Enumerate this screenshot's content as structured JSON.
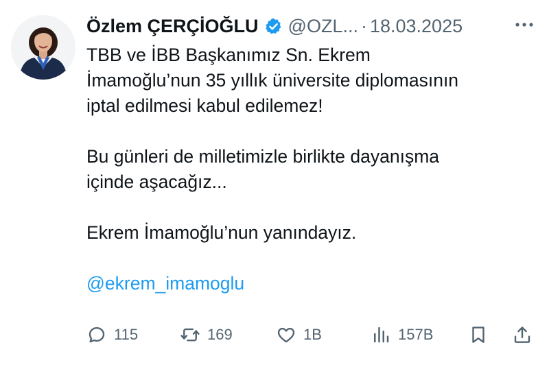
{
  "author": {
    "name": "Özlem ÇERÇİOĞLU",
    "handle": "@OZL...",
    "separator": "·",
    "date": "18.03.2025",
    "avatar_icon": "profile-photo",
    "verified_icon": "verified-badge-icon",
    "verified_color": "#1d9bf0"
  },
  "tweet": {
    "line1": "TBB ve İBB Başkanımız Sn. Ekrem",
    "line2": "İmamoğlu’nun 35 yıllık üniversite diplomasının",
    "line3": "iptal edilmesi kabul edilemez!",
    "line4": "Bu günleri de milletimizle birlikte dayanışma",
    "line5": "içinde aşacağız...",
    "line6": "Ekrem İmamoğlu’nun yanındayız.",
    "mention": "@ekrem_imamoglu",
    "mention_color": "#1d9bf0"
  },
  "actions": {
    "replies": "115",
    "retweets": "169",
    "likes": "1B",
    "views": "157B",
    "icons": [
      "reply-icon",
      "retweet-icon",
      "like-icon",
      "views-icon",
      "bookmark-icon",
      "share-icon"
    ],
    "icon_color": "#536471"
  }
}
